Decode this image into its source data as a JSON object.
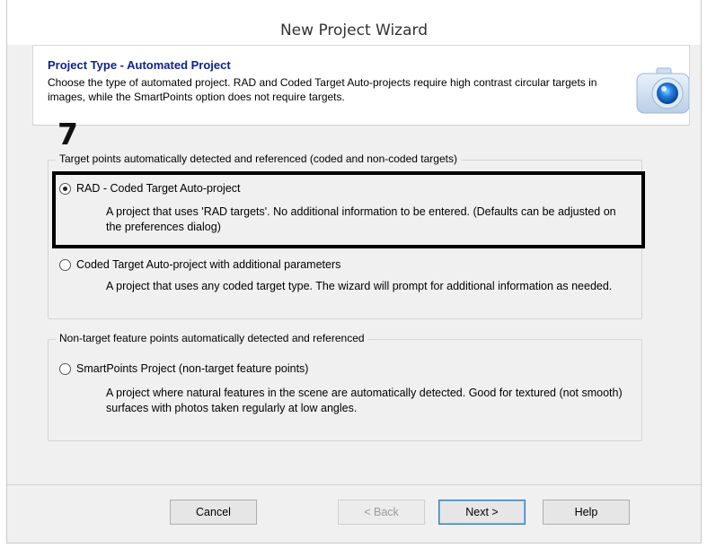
{
  "window": {
    "title": "New Project Wizard"
  },
  "header": {
    "title": "Project Type - Automated Project",
    "description": "Choose the type of automated project.  RAD and Coded Target Auto-projects require high contrast circular targets in images, while the SmartPoints option does not require targets.",
    "icon": "camera-icon"
  },
  "annotation": {
    "step_number": "7"
  },
  "groups": [
    {
      "legend": "Target points automatically detected and referenced (coded and non-coded targets)",
      "options": [
        {
          "label": "RAD - Coded Target Auto-project",
          "description": "A project that uses 'RAD targets'. No additional information to be entered.  (Defaults can be adjusted on the preferences dialog)",
          "selected": true
        },
        {
          "label": "Coded Target Auto-project with additional parameters",
          "description": "A project that uses any coded target type.  The wizard will prompt for additional information as needed.",
          "selected": false
        }
      ]
    },
    {
      "legend": "Non-target feature points automatically detected and referenced",
      "options": [
        {
          "label": "SmartPoints Project (non-target feature points)",
          "description": "A project where natural features in the scene are automatically detected. Good for textured (not smooth) surfaces with photos taken regularly at low angles.",
          "selected": false
        }
      ]
    }
  ],
  "buttons": {
    "cancel": "Cancel",
    "back": "< Back",
    "next": "Next >",
    "help": "Help"
  },
  "colors": {
    "header_title": "#0f238c",
    "highlight_border": "#000000",
    "window_bg": "#f0f0f0"
  }
}
